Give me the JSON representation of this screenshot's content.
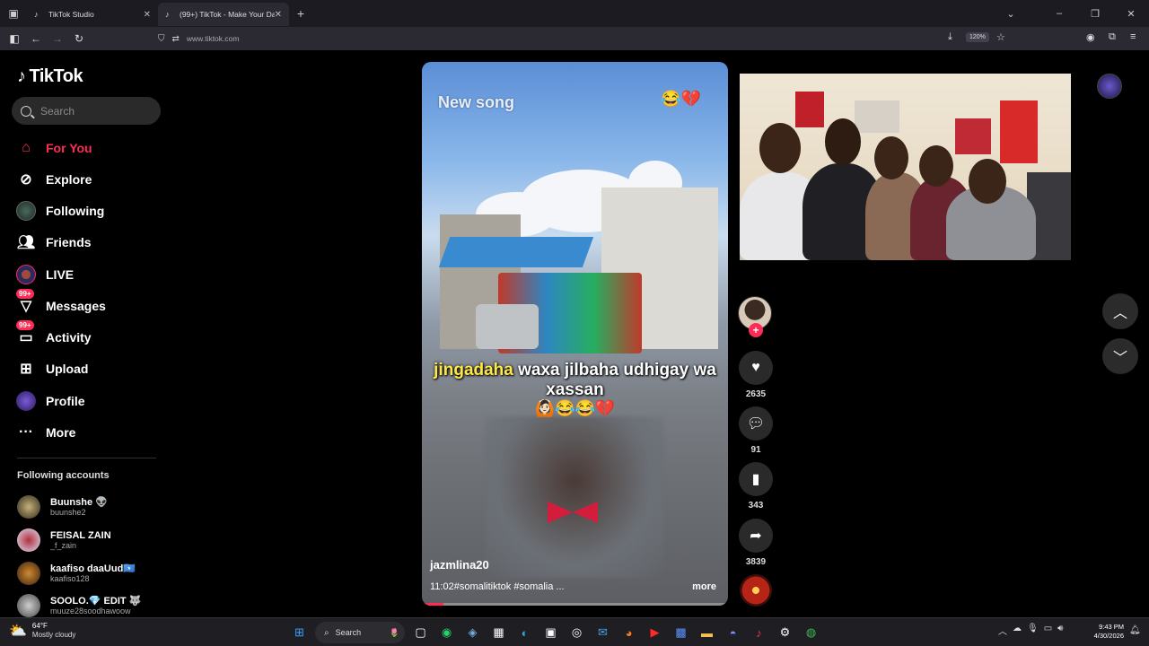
{
  "browser": {
    "tabs": [
      {
        "title": "TikTok Studio",
        "active": false
      },
      {
        "title": "(99+) TikTok - Make Your Day",
        "active": true
      }
    ],
    "url": "www.tiktok.com",
    "zoom": "120%"
  },
  "sidebar": {
    "logo": "TikTok",
    "search_placeholder": "Search",
    "nav": [
      {
        "label": "For You",
        "icon": "home-icon",
        "active": true
      },
      {
        "label": "Explore",
        "icon": "compass-icon"
      },
      {
        "label": "Following",
        "icon": "following-avatar-icon"
      },
      {
        "label": "Friends",
        "icon": "friends-icon"
      },
      {
        "label": "LIVE",
        "icon": "live-icon"
      },
      {
        "label": "Messages",
        "icon": "messages-icon",
        "badge": "99+"
      },
      {
        "label": "Activity",
        "icon": "activity-icon",
        "badge": "99+"
      },
      {
        "label": "Upload",
        "icon": "upload-icon"
      },
      {
        "label": "Profile",
        "icon": "profile-icon"
      },
      {
        "label": "More",
        "icon": "more-icon"
      }
    ],
    "following_title": "Following accounts",
    "accounts": [
      {
        "name": "Buunshe 👽",
        "handle": "buunshe2"
      },
      {
        "name": "FEISAL ZAIN",
        "handle": "_f_zain"
      },
      {
        "name": "kaafiso daaUud🇸🇴",
        "handle": "kaafiso128"
      },
      {
        "name": "SOOLO.💎 EDIT 🐺",
        "handle": "muuze28soodhawoow"
      }
    ]
  },
  "video": {
    "caption_top": "New song",
    "emoji_top": "😂💔",
    "lyric_highlight": "jingadaha",
    "lyric_rest": " waxa jilbaha udhigay wa xassan",
    "lyric_emoji": "🙆🏻😂😂💔",
    "username": "jazmlina20",
    "description": "11:02#somalitiktok #somalia ...",
    "more": "more",
    "progress_fraction": 0.07
  },
  "actions": {
    "likes": "2635",
    "comments": "91",
    "saves": "343",
    "shares": "3839"
  },
  "overlay": {
    "get_app_partial": "p"
  },
  "taskbar": {
    "temp": "64°F",
    "weather": "Mostly cloudy",
    "search": "Search",
    "time": "9:43 PM",
    "date": "4/30/2026"
  },
  "colors": {
    "accent": "#fe2c55",
    "background": "#000000"
  }
}
